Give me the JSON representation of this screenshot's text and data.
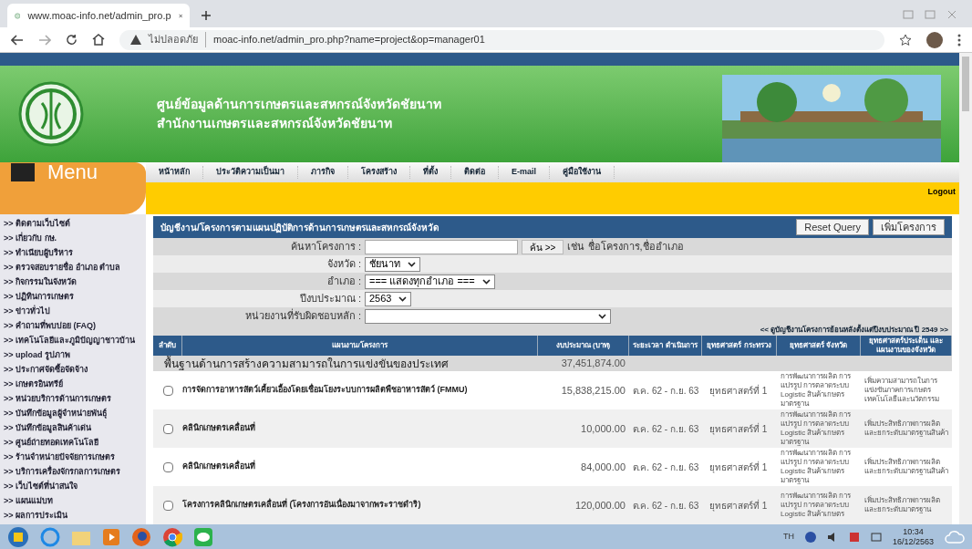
{
  "browser": {
    "tab_title": "www.moac-info.net/admin_pro.p",
    "security": "ไม่ปลอดภัย",
    "url": "moac-info.net/admin_pro.php?name=project&op=manager01"
  },
  "header": {
    "title": "ศูนย์ข้อมูลด้านการเกษตรและสหกรณ์จังหวัดชัยนาท",
    "subtitle": "สำนักงานเกษตรและสหกรณ์จังหวัดชัยนาท"
  },
  "menu_title": "Menu",
  "nav": [
    "หน้าหลัก",
    "ประวัติความเป็นมา",
    "ภารกิจ",
    "โครงสร้าง",
    "ที่ตั้ง",
    "ติดต่อ",
    "E-mail",
    "คู่มือใช้งาน"
  ],
  "logout": "Logout",
  "sidebar": {
    "prefix": ">>",
    "items": [
      "ติดตามเว็บไซต์",
      "เกี่ยวกับ กษ.",
      "ทำเนียบผู้บริหาร",
      "ตรวจสอบรายชื่อ อำเภอ ตำบล",
      "กิจกรรมในจังหวัด",
      "ปฏิทินการเกษตร",
      "ข่าวทั่วไป",
      "คำถามที่พบบ่อย (FAQ)",
      "เทคโนโลยีและภูมิปัญญาชาวบ้าน",
      "upload รูปภาพ",
      "ประกาศจัดซื้อจัดจ้าง",
      "เกษตรอินทรีย์",
      "หน่วยบริการด้านการเกษตร",
      "บันทึกข้อมูลผู้จำหน่ายพันธุ์",
      "บันทึกข้อมูลสินค้าเด่น",
      "ศูนย์ถ่ายทอดเทคโนโลยี",
      "ร้านจำหน่ายปัจจัยการเกษตร",
      "บริการเครื่องจักรกลการเกษตร",
      "เว็บไซต์ที่น่าสนใจ",
      "แผนแม่บท",
      "ผลการประเมิน"
    ]
  },
  "panel": {
    "title": "บัญชีงาน/โครงการตามแผนปฏิบัติการด้านการเกษตรและสหกรณ์จังหวัด",
    "buttons": [
      "Reset Query",
      "เพิ่มโครงการ"
    ]
  },
  "filters": [
    {
      "kind": "search",
      "label": "ค้นหาโครงการ :",
      "button": "ค้น >>",
      "hint": "เช่น ชื่อโครงการ,ชื่ออำเภอ"
    },
    {
      "kind": "select",
      "label": "จังหวัด :",
      "value": "ชัยนาท"
    },
    {
      "kind": "select",
      "label": "อำเภอ :",
      "value": "=== แสดงทุกอำเภอ ==="
    },
    {
      "kind": "select",
      "label": "ปีงบประมาณ :",
      "value": "2563"
    },
    {
      "kind": "wide_select",
      "label": "หน่วยงานที่รับผิดชอบหลัก :"
    }
  ],
  "history_link": "<< ดูบัญชีงานโครงการย้อนหลังตั้งแต่ปีงบประมาณ ปี 2549 >>",
  "table": {
    "columns": [
      "ลำดับ",
      "แผนงาน/โครงการ",
      "งบประมาณ (บาท)",
      "ระยะเวลา ดำเนินการ",
      "ยุทธศาสตร์ กระทรวง",
      "ยุทธศาสตร์ จังหวัด",
      "ยุทธศาสตร์ประเด็น และแผนงานของจังหวัด"
    ],
    "group": {
      "name": "พื้นฐานด้านการสร้างความสามารถในการแข่งขันของประเทศ",
      "budget": "37,451,874.00"
    },
    "rows": [
      {
        "checked": false,
        "name": "การจัดการอาหารสัตว์เคี้ยวเอื้องโดยเชื่อมโยงระบบการผลิตพืชอาหารสัตว์ (FMMU)",
        "budget": "15,838,215.00",
        "period": "ต.ค. 62 - ก.ย. 63",
        "ministry": "ยุทธศาสตร์ที่ 1",
        "province": "การพัฒนาการผลิต การแปรรูป การตลาดระบบ Logistic สินค้าเกษตรมาตรฐาน",
        "plan": "เพิ่มความสามารถในการแข่งขันภาคการเกษตรเทคโนโลยีและนวัตกรรม"
      },
      {
        "checked": false,
        "name": "คลินิกเกษตรเคลื่อนที่",
        "budget": "10,000.00",
        "period": "ต.ค. 62 - ก.ย. 63",
        "ministry": "ยุทธศาสตร์ที่ 1",
        "province": "การพัฒนาการผลิต การแปรรูป การตลาดระบบ Logistic สินค้าเกษตรมาตรฐาน",
        "plan": "เพิ่มประสิทธิภาพการผลิตและยกระดับมาตรฐานสินค้า"
      },
      {
        "checked": false,
        "name": "คลินิกเกษตรเคลื่อนที่",
        "budget": "84,000.00",
        "period": "ต.ค. 62 - ก.ย. 63",
        "ministry": "ยุทธศาสตร์ที่ 1",
        "province": "การพัฒนาการผลิต การแปรรูป การตลาดระบบ Logistic สินค้าเกษตรมาตรฐาน",
        "plan": "เพิ่มประสิทธิภาพการผลิตและยกระดับมาตรฐานสินค้า"
      },
      {
        "checked": false,
        "name": "โครงการคลินิกเกษตรเคลื่อนที่ (โครงการอันเนื่องมาจากพระราชดำริ)",
        "budget": "120,000.00",
        "period": "ต.ค. 62 - ก.ย. 63",
        "ministry": "ยุทธศาสตร์ที่ 1",
        "province": "การพัฒนาการผลิต การแปรรูป การตลาดระบบ Logistic สินค้าเกษตร",
        "plan": "เพิ่มประสิทธิภาพการผลิตและยกระดับมาตรฐาน"
      }
    ]
  },
  "taskbar": {
    "language": "TH",
    "time": "10:34",
    "date": "16/12/2563"
  }
}
